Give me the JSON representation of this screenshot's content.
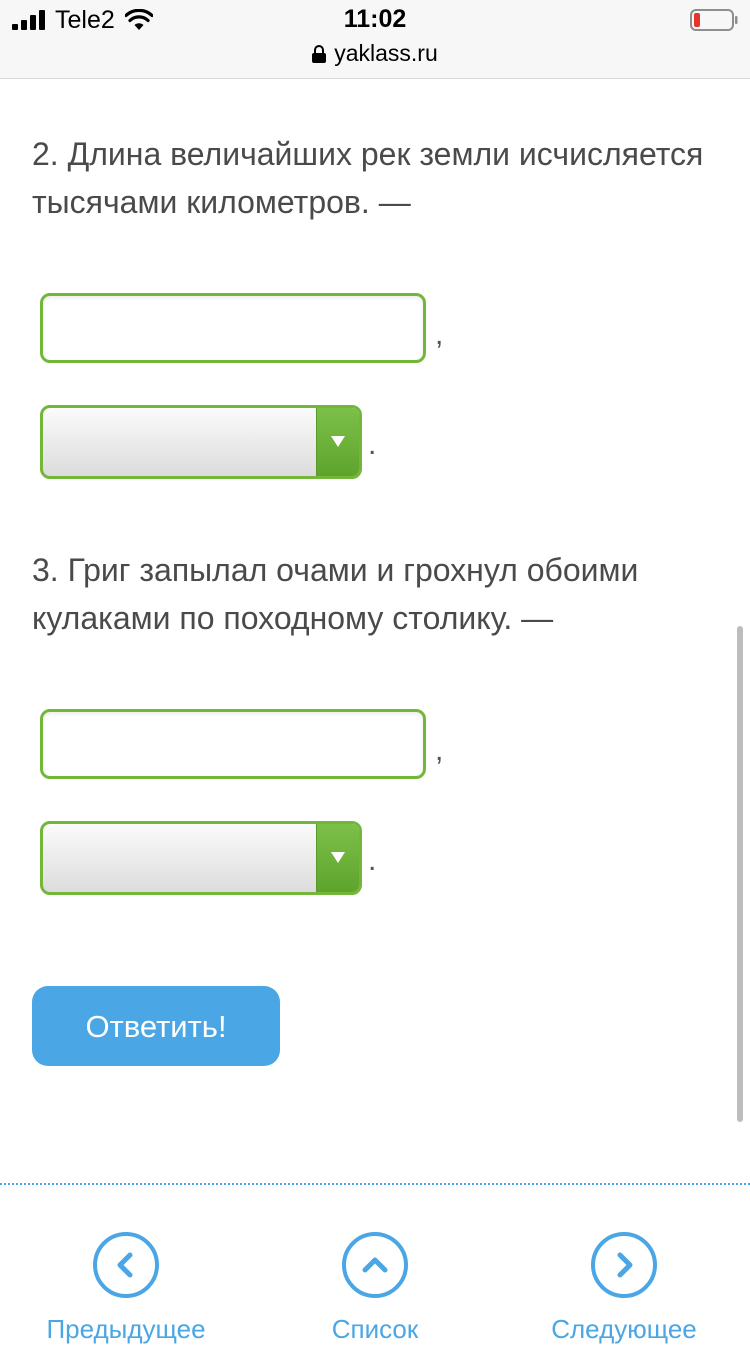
{
  "status_bar": {
    "carrier": "Tele2",
    "time": "11:02",
    "url": "yaklass.ru"
  },
  "questions": [
    {
      "text": "2. Длина величайших рек земли исчисляется тысячами километров. —",
      "input_value": "",
      "comma": ",",
      "select_value": "",
      "period": "."
    },
    {
      "text": "3. Григ запылал очами и грохнул обоими кулаками по походному столику. —",
      "input_value": "",
      "comma": ",",
      "select_value": "",
      "period": "."
    }
  ],
  "answer_button": {
    "label": "Ответить!"
  },
  "bottom_nav": {
    "prev_label": "Предыдущее",
    "list_label": "Список",
    "next_label": "Следующее"
  },
  "colors": {
    "accent_blue": "#4aa6e4",
    "field_green": "#74b63a",
    "text_gray": "#4a4a4a"
  }
}
